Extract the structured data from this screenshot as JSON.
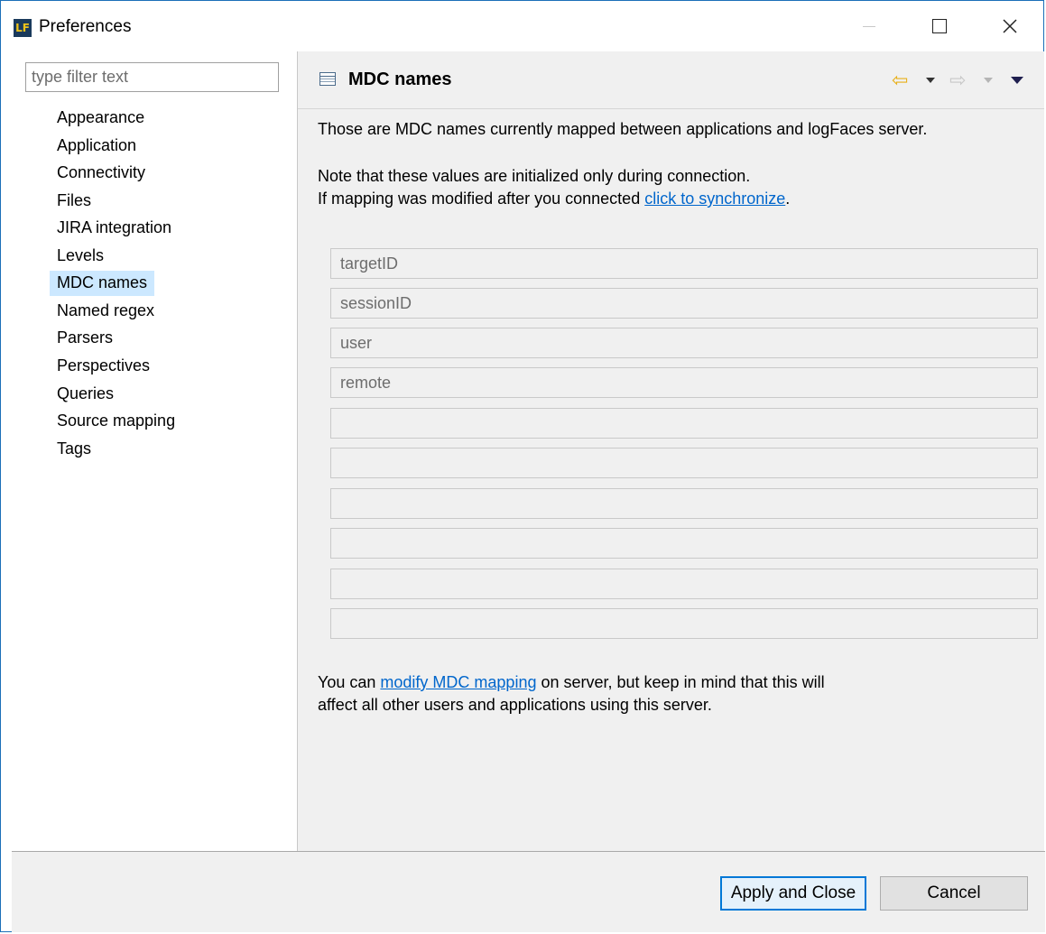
{
  "window": {
    "title": "Preferences",
    "logo_text": "LF",
    "controls": {
      "minimize": "—",
      "close": "✕"
    }
  },
  "sidebar": {
    "filter_placeholder": "type filter text",
    "items": [
      {
        "label": "Appearance"
      },
      {
        "label": "Application"
      },
      {
        "label": "Connectivity"
      },
      {
        "label": "Files"
      },
      {
        "label": "JIRA integration"
      },
      {
        "label": "Levels"
      },
      {
        "label": "MDC names",
        "selected": true
      },
      {
        "label": "Named regex"
      },
      {
        "label": "Parsers"
      },
      {
        "label": "Perspectives"
      },
      {
        "label": "Queries"
      },
      {
        "label": "Source mapping"
      },
      {
        "label": "Tags"
      }
    ]
  },
  "page": {
    "title": "MDC names",
    "nav": {
      "back_icon": "⇦",
      "forward_icon": "⇨"
    },
    "intro": "Those are MDC names currently mapped between applications and logFaces server.",
    "note_line1": "Note that these values are initialized only during connection.",
    "note_line2_prefix": "If mapping was modified after you connected ",
    "note_link": "click to synchronize",
    "note_line2_suffix": ".",
    "fields": [
      "targetID",
      "sessionID",
      "user",
      "remote",
      "",
      "",
      "",
      "",
      "",
      ""
    ],
    "footer_prefix": "You can ",
    "footer_link": "modify MDC mapping",
    "footer_suffix": " on server, but keep in mind that this will",
    "footer_line2": "affect all other users and applications using this server."
  },
  "buttons": {
    "apply": "Apply and Close",
    "cancel": "Cancel"
  },
  "colors": {
    "accent": "#0078d7",
    "link": "#0066cc",
    "selection": "#cce8ff",
    "panel_bg": "#f0f0f0"
  }
}
